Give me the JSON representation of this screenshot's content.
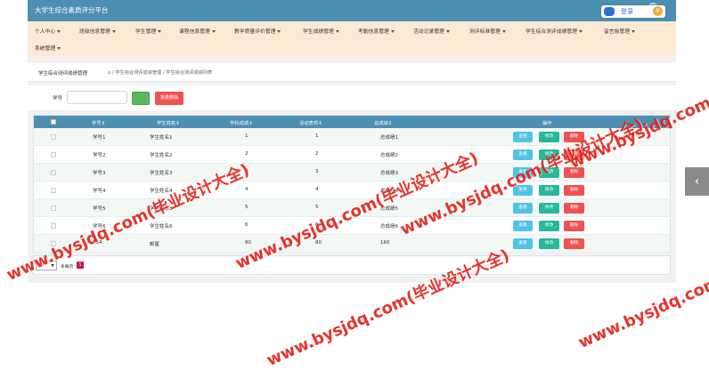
{
  "app": {
    "title": "大学生综合素质评分平台"
  },
  "header": {
    "login_label": "登录",
    "coin_label": "¥"
  },
  "nav": {
    "items": [
      {
        "label": "个人中心"
      },
      {
        "label": "班级信息管理"
      },
      {
        "label": "学生管理"
      },
      {
        "label": "课程信息管理"
      },
      {
        "label": "教学质量评价管理"
      },
      {
        "label": "学生成绩管理"
      },
      {
        "label": "考勤信息管理"
      },
      {
        "label": "活动记录管理"
      },
      {
        "label": "测评标准管理"
      },
      {
        "label": "学生综合测评成绩管理"
      },
      {
        "label": "留言板管理"
      },
      {
        "label": "系统管理"
      }
    ]
  },
  "breadcrumb": {
    "title": "学生综合测评成绩管理",
    "path": "⌂ / 学生综合测评成绩管理 / 学生综合测评成绩列表"
  },
  "search": {
    "label": "学号",
    "input_value": "",
    "batch_delete_label": "批量删除"
  },
  "table": {
    "columns": [
      "学号⇕",
      "学生姓名⇕",
      "学科成绩⇕",
      "活动表现⇕",
      "总成绩⇕",
      "操作"
    ],
    "rows": [
      {
        "student_no": "学号1",
        "name": "学生姓名1",
        "subject": "1",
        "activity": "1",
        "total": "总成绩1"
      },
      {
        "student_no": "学号2",
        "name": "学生姓名2",
        "subject": "2",
        "activity": "2",
        "total": "总成绩2"
      },
      {
        "student_no": "学号3",
        "name": "学生姓名3",
        "subject": "3",
        "activity": "3",
        "total": "总成绩3"
      },
      {
        "student_no": "学号4",
        "name": "学生姓名4",
        "subject": "4",
        "activity": "4",
        "total": "总成绩4"
      },
      {
        "student_no": "学号5",
        "name": "学生姓名5",
        "subject": "5",
        "activity": "5",
        "total": "总成绩5"
      },
      {
        "student_no": "学号6",
        "name": "学生姓名6",
        "subject": "6",
        "activity": "6",
        "total": "总成绩6"
      },
      {
        "student_no": "234",
        "name": "邮星",
        "subject": "80",
        "activity": "80",
        "total": "160"
      }
    ],
    "actions": {
      "view": "查看",
      "edit": "修改",
      "delete": "删除"
    },
    "colors": {
      "header": "#4d8fb3",
      "view": "#4fc3e8",
      "edit": "#26b99a",
      "delete": "#ef5350"
    }
  },
  "pager": {
    "page_size": "10",
    "total_label": "条每页",
    "current_page": "1"
  },
  "watermark": {
    "text": "www.bysjdq.com(毕业设计大全)"
  }
}
